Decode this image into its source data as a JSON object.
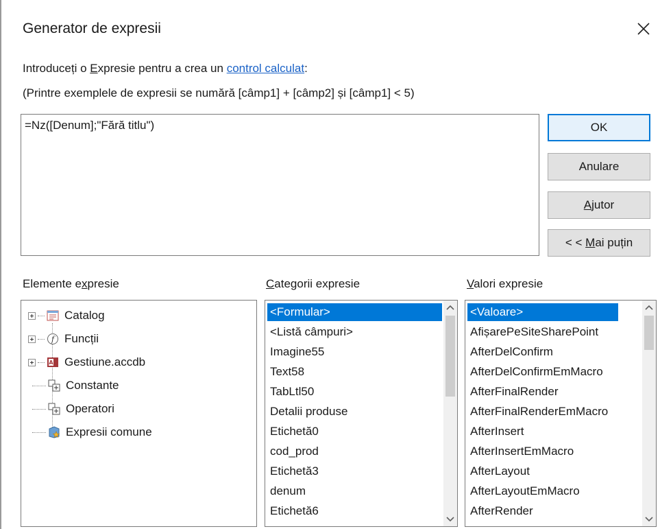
{
  "dialog": {
    "title": "Generator de expresii"
  },
  "intro": {
    "prefix": "Introduceți o ",
    "accel_letter": "E",
    "mid": "xpresie pentru a crea un ",
    "link": "control calculat",
    "suffix": ":"
  },
  "examples": "(Printre exemplele de expresii se numără [câmp1] + [câmp2] și [câmp1] < 5)",
  "expression": {
    "value": "=Nz([Denum];\"Fără titlu\")"
  },
  "buttons": {
    "ok": "OK",
    "cancel": "Anulare",
    "help_accel": "A",
    "help_rest": "jutor",
    "less_prefix": "< < ",
    "less_accel": "M",
    "less_rest": "ai puțin"
  },
  "columns": {
    "elements_a": "Elemente e",
    "elements_accel": "x",
    "elements_b": "presie",
    "categories_accel": "C",
    "categories_rest": "ategorii expresie",
    "values_accel": "V",
    "values_rest": "alori expresie"
  },
  "elements_tree": [
    {
      "label": "Catalog",
      "icon": "form-icon",
      "expandable": true
    },
    {
      "label": "Funcții",
      "icon": "function-icon",
      "expandable": true
    },
    {
      "label": "Gestiune.accdb",
      "icon": "database-icon",
      "expandable": true
    },
    {
      "label": "Constante",
      "icon": "constant-icon",
      "expandable": false
    },
    {
      "label": "Operatori",
      "icon": "operator-icon",
      "expandable": false
    },
    {
      "label": "Expresii comune",
      "icon": "common-expression-icon",
      "expandable": false
    }
  ],
  "categories": {
    "selected": "<Formular>",
    "items": [
      "<Formular>",
      "<Listă câmpuri>",
      "Imagine55",
      "Text58",
      "TabLtl50",
      "Detalii produse",
      "Etichetă0",
      "cod_prod",
      "Etichetă3",
      "denum",
      "Etichetă6"
    ]
  },
  "values": {
    "selected": "<Valoare>",
    "items": [
      "<Valoare>",
      "AfișarePeSiteSharePoint",
      "AfterDelConfirm",
      "AfterDelConfirmEmMacro",
      "AfterFinalRender",
      "AfterFinalRenderEmMacro",
      "AfterInsert",
      "AfterInsertEmMacro",
      "AfterLayout",
      "AfterLayoutEmMacro",
      "AfterRender"
    ]
  },
  "colors": {
    "selection": "#0078d7",
    "link": "#1a62c7",
    "default_button_border": "#0078d7"
  }
}
